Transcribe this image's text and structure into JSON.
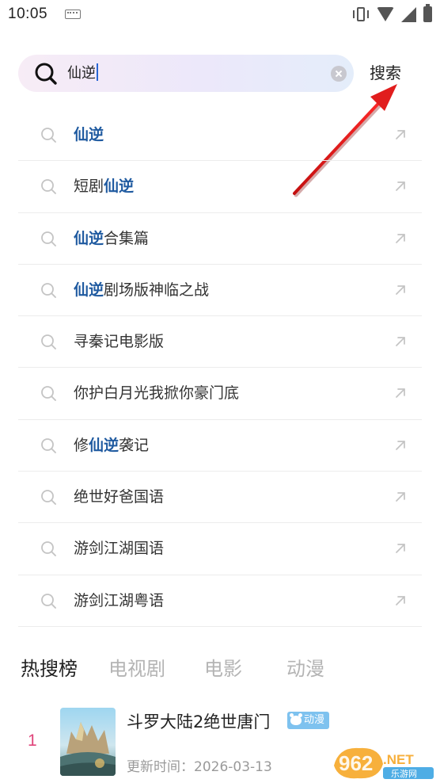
{
  "status_bar": {
    "time": "10:05"
  },
  "search": {
    "query": "仙逆",
    "button_label": "搜索"
  },
  "suggestions": [
    {
      "pre": "",
      "hl": "仙逆",
      "post": ""
    },
    {
      "pre": "短剧",
      "hl": "仙逆",
      "post": ""
    },
    {
      "pre": "",
      "hl": "仙逆",
      "post": "合集篇"
    },
    {
      "pre": "",
      "hl": "仙逆",
      "post": "剧场版神临之战"
    },
    {
      "pre": "寻秦记电影版",
      "hl": "",
      "post": ""
    },
    {
      "pre": "你护白月光我掀你豪门底",
      "hl": "",
      "post": ""
    },
    {
      "pre": "修",
      "hl": "仙逆",
      "post": "袭记"
    },
    {
      "pre": "绝世好爸国语",
      "hl": "",
      "post": ""
    },
    {
      "pre": "游剑江湖国语",
      "hl": "",
      "post": ""
    },
    {
      "pre": "游剑江湖粤语",
      "hl": "",
      "post": ""
    }
  ],
  "hot_tabs": [
    "热搜榜",
    "电视剧",
    "电影",
    "动漫"
  ],
  "ranking": [
    {
      "rank": "1",
      "title": "斗罗大陆2绝世唐门",
      "tag": "动漫",
      "update_label": "更新时间：2026-03-13"
    }
  ],
  "watermark": {
    "text": "962.NET",
    "subtext": "乐游网"
  },
  "colors": {
    "highlight": "#1f5aa0",
    "rank": "#e0457b",
    "tag": "#7ec2ef",
    "annotation": "#e11d1d"
  }
}
